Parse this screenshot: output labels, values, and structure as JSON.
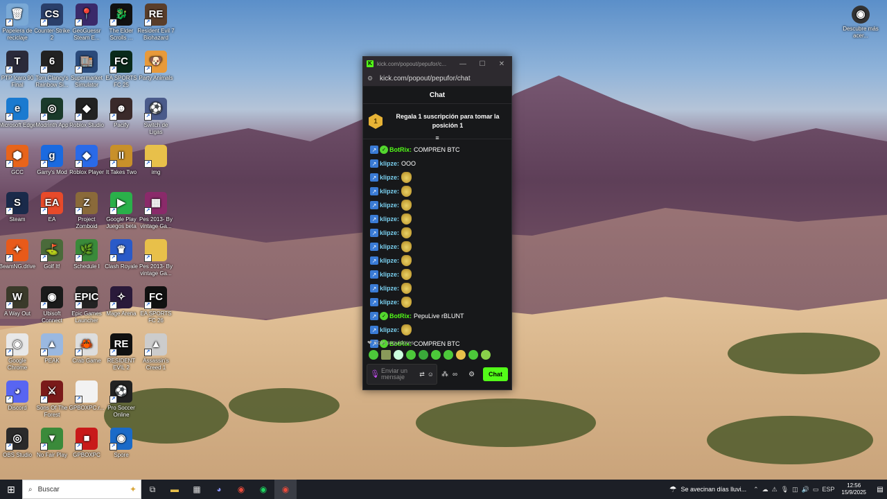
{
  "desktop_icons": [
    {
      "label": "Papelera de reciclaje",
      "icon": "recycle-bin-icon",
      "color": "#7aa9d6",
      "glyph": "🗑"
    },
    {
      "label": "Counter-Strike 2",
      "icon": "counter-strike-icon",
      "color": "#2a3f6a",
      "glyph": "CS"
    },
    {
      "label": "GeoGuessr Steam E...",
      "icon": "geoguessr-icon",
      "color": "#3a2a6a",
      "glyph": "📍"
    },
    {
      "label": "The Elder Scrolls ...",
      "icon": "elder-scrolls-icon",
      "color": "#111",
      "glyph": "🐉"
    },
    {
      "label": "Resident Evil 7 Biohazard",
      "icon": "resident-evil-icon",
      "color": "#5a3e2a",
      "glyph": "RE"
    },
    {
      "label": "PTP Icaro 90 Final",
      "icon": "ptp-icaro-icon",
      "color": "#2a2a3a",
      "glyph": "T"
    },
    {
      "label": "Tom Clancy's Rainbow Si...",
      "icon": "rainbow-six-icon",
      "color": "#222",
      "glyph": "6"
    },
    {
      "label": "Supermarket Simulator",
      "icon": "supermarket-icon",
      "color": "#2a4a7a",
      "glyph": "🏬"
    },
    {
      "label": "EA SPORTS FC 25",
      "icon": "fc25-icon",
      "color": "#0a2a1a",
      "glyph": "FC"
    },
    {
      "label": "Party Animals",
      "icon": "party-animals-icon",
      "color": "#e89a3a",
      "glyph": "🐶"
    },
    {
      "label": "Microsoft Edge",
      "icon": "edge-icon",
      "color": "#1a7ad0",
      "glyph": "e"
    },
    {
      "label": "Modrinth App",
      "icon": "modrinth-icon",
      "color": "#1a3a2a",
      "glyph": "◎"
    },
    {
      "label": "Roblox Studio",
      "icon": "roblox-studio-icon",
      "color": "#222",
      "glyph": "◆"
    },
    {
      "label": "Pacify",
      "icon": "pacify-icon",
      "color": "#3a2a2a",
      "glyph": "☻"
    },
    {
      "label": "Switch de Ligas",
      "icon": "switch-ligas-icon",
      "color": "#4a5a8a",
      "glyph": "⚽"
    },
    {
      "label": "GCC",
      "icon": "gcc-icon",
      "color": "#e8641a",
      "glyph": "⬢"
    },
    {
      "label": "Garry's Mod",
      "icon": "garrys-mod-icon",
      "color": "#1a6ae0",
      "glyph": "g"
    },
    {
      "label": "Roblox Player",
      "icon": "roblox-player-icon",
      "color": "#2a6ae8",
      "glyph": "◆"
    },
    {
      "label": "It Takes Two",
      "icon": "it-takes-two-icon",
      "color": "#c8902a",
      "glyph": "II"
    },
    {
      "label": "img",
      "icon": "folder-icon",
      "color": "#e8c04a",
      "glyph": ""
    },
    {
      "label": "Steam",
      "icon": "steam-icon",
      "color": "#1a2a4a",
      "glyph": "S"
    },
    {
      "label": "EA",
      "icon": "ea-icon",
      "color": "#e84a2a",
      "glyph": "EA"
    },
    {
      "label": "Project Zomboid",
      "icon": "zomboid-icon",
      "color": "#8a6a3a",
      "glyph": "Z"
    },
    {
      "label": "Google Play Juegos beta",
      "icon": "google-play-icon",
      "color": "#2ab04a",
      "glyph": "▶"
    },
    {
      "label": "Pes 2013- By vintage Ga...",
      "icon": "winrar-icon",
      "color": "#8a2a6a",
      "glyph": "▦"
    },
    {
      "label": "BeamNG.drive",
      "icon": "beamng-icon",
      "color": "#e85a1a",
      "glyph": "✦"
    },
    {
      "label": "Golf It!",
      "icon": "golf-it-icon",
      "color": "#4a6a3a",
      "glyph": "⛳"
    },
    {
      "label": "Schedule I",
      "icon": "schedule-one-icon",
      "color": "#3a8a3a",
      "glyph": "🌿"
    },
    {
      "label": "Clash Royale",
      "icon": "clash-royale-icon",
      "color": "#2a5ac8",
      "glyph": "♛"
    },
    {
      "label": "Pes 2013- By vintage Ga...",
      "icon": "folder-icon",
      "color": "#e8c04a",
      "glyph": ""
    },
    {
      "label": "A Way Out",
      "icon": "a-way-out-icon",
      "color": "#3a3a2a",
      "glyph": "W"
    },
    {
      "label": "Ubisoft Connect",
      "icon": "ubisoft-icon",
      "color": "#1a1a1a",
      "glyph": "◉"
    },
    {
      "label": "Epic Games Launcher",
      "icon": "epic-games-icon",
      "color": "#222",
      "glyph": "EPIC"
    },
    {
      "label": "Mage Arena",
      "icon": "mage-arena-icon",
      "color": "#2a1a3a",
      "glyph": "✧"
    },
    {
      "label": "EA SPORTS FC 26",
      "icon": "fc26-icon",
      "color": "#111",
      "glyph": "FC"
    },
    {
      "label": "Google Chrome",
      "icon": "chrome-icon",
      "color": "#e8e8e8",
      "glyph": "◉"
    },
    {
      "label": "PEAK",
      "icon": "peak-icon",
      "color": "#9ab8e0",
      "glyph": "▲"
    },
    {
      "label": "Crab Game",
      "icon": "crab-game-icon",
      "color": "#ddd",
      "glyph": "🦀"
    },
    {
      "label": "RESIDENT EVIL 2",
      "icon": "resident-evil-2-icon",
      "color": "#111",
      "glyph": "RE"
    },
    {
      "label": "Assassin's Creed 1",
      "icon": "assassins-creed-icon",
      "color": "#ccc",
      "glyph": "▲"
    },
    {
      "label": "Discord",
      "icon": "discord-icon",
      "color": "#5865f2",
      "glyph": "◕"
    },
    {
      "label": "Sons Of The Forest",
      "icon": "sons-forest-icon",
      "color": "#7a1a1a",
      "glyph": "⚔"
    },
    {
      "label": "GPBOXPC.r...",
      "icon": "file-icon",
      "color": "#f2f2f2",
      "glyph": ""
    },
    {
      "label": "Pro Soccer Online",
      "icon": "pro-soccer-icon",
      "color": "#222",
      "glyph": "⚽"
    },
    {
      "label": "",
      "icon": "blank-icon",
      "color": "transparent",
      "glyph": ""
    },
    {
      "label": "OBS Studio",
      "icon": "obs-icon",
      "color": "#2a2a2a",
      "glyph": "◎"
    },
    {
      "label": "No Fair Play",
      "icon": "no-fair-play-icon",
      "color": "#3a8a3a",
      "glyph": "▼"
    },
    {
      "label": "GPBOXPC",
      "icon": "gpbox-icon",
      "color": "#c81a1a",
      "glyph": "■"
    },
    {
      "label": "Spore",
      "icon": "spore-icon",
      "color": "#1a6ac8",
      "glyph": "◉"
    }
  ],
  "discover_icon": {
    "label": "Descubre más acer...",
    "icon": "discover-icon"
  },
  "window": {
    "title": "kick.com/popout/pepufor/c...",
    "url": "kick.com/popout/pepufor/chat",
    "minimize": "—",
    "maximize": "☐",
    "close": "✕"
  },
  "chat": {
    "header": "Chat",
    "promo_number": "1",
    "promo_text": "Regala 1 suscripción para tomar la posición 1",
    "pin_glyph": "≡",
    "messages": [
      {
        "user": "BotRix",
        "verified": true,
        "text": "COMPREN BTC",
        "emote": false
      },
      {
        "user": "klipze",
        "verified": false,
        "text": "OOO",
        "emote": false
      },
      {
        "user": "klipze",
        "verified": false,
        "text": "",
        "emote": true
      },
      {
        "user": "klipze",
        "verified": false,
        "text": "",
        "emote": true
      },
      {
        "user": "klipze",
        "verified": false,
        "text": "",
        "emote": true
      },
      {
        "user": "klipze",
        "verified": false,
        "text": "",
        "emote": true
      },
      {
        "user": "klipze",
        "verified": false,
        "text": "",
        "emote": true
      },
      {
        "user": "klipze",
        "verified": false,
        "text": "",
        "emote": true
      },
      {
        "user": "klipze",
        "verified": false,
        "text": "",
        "emote": true
      },
      {
        "user": "klipze",
        "verified": false,
        "text": "",
        "emote": true
      },
      {
        "user": "klipze",
        "verified": false,
        "text": "",
        "emote": true
      },
      {
        "user": "klipze",
        "verified": false,
        "text": "",
        "emote": true
      },
      {
        "user": "BotRix",
        "verified": true,
        "text": "PepuLive rBLUNT",
        "emote": false
      },
      {
        "user": "klipze",
        "verified": false,
        "text": "",
        "emote": true
      },
      {
        "user": "BotRix",
        "verified": true,
        "text": "COMPREN BTC",
        "emote": false
      }
    ],
    "followers_only": "Solo seguidores",
    "input_placeholder": "Enviar un mensaje",
    "send_label": "Chat"
  },
  "taskbar": {
    "search_placeholder": "Buscar",
    "weather_text": "Se avecinan días lluvi...",
    "language": "ESP",
    "time": "12:56",
    "date": "15/9/2025"
  },
  "colors": {
    "kick_green": "#53fc18",
    "chat_bg": "#17181a",
    "taskbar_bg": "#1c1f26"
  }
}
